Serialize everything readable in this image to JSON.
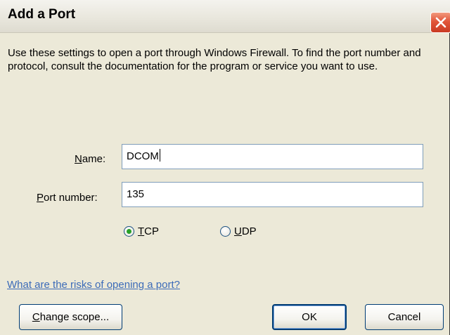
{
  "window": {
    "title": "Add a Port",
    "close_icon": "close-icon"
  },
  "description": "Use these settings to open a port through Windows Firewall. To find the port number and protocol, consult the documentation for the program or service you want to use.",
  "form": {
    "name_label_mnemonic": "N",
    "name_label_rest": "ame:",
    "name_value": "DCOM",
    "port_label_mnemonic": "P",
    "port_label_rest": "ort number:",
    "port_value": "135",
    "protocol_selected": "TCP",
    "tcp_mnemonic": "T",
    "tcp_rest": "CP",
    "udp_mnemonic": "U",
    "udp_rest": "DP"
  },
  "link": {
    "text": "What are the risks of opening a port?"
  },
  "buttons": {
    "change_scope_mnemonic": "C",
    "change_scope_rest": "hange scope...",
    "ok_label": "OK",
    "cancel_label": "Cancel"
  },
  "colors": {
    "dialog_bg": "#ece9d8",
    "link": "#3c6bb8",
    "close_button": "#e2553a",
    "radio_selected": "#27a127"
  }
}
